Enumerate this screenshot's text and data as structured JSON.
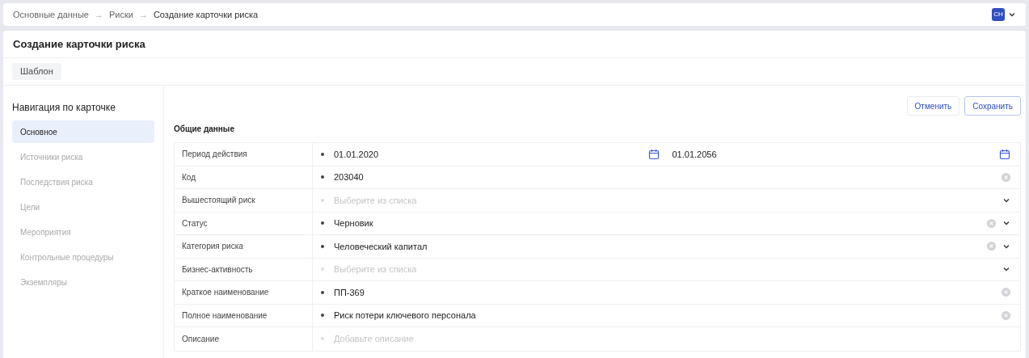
{
  "breadcrumbs": [
    "Основные данные",
    "Риски",
    "Создание карточки риска"
  ],
  "breadcrumb_separator": "→",
  "user": {
    "initials": "СН"
  },
  "page_title": "Создание карточки риска",
  "template_button": "Шаблон",
  "sidebar": {
    "title": "Навигация по карточке",
    "items": [
      {
        "label": "Основное",
        "selected": true
      },
      {
        "label": "Источники риска",
        "selected": false
      },
      {
        "label": "Последствия риска",
        "selected": false
      },
      {
        "label": "Цели",
        "selected": false
      },
      {
        "label": "Мероприятия",
        "selected": false
      },
      {
        "label": "Контрольные процедуры",
        "selected": false
      },
      {
        "label": "Экземпляры",
        "selected": false
      }
    ]
  },
  "actions": {
    "cancel": "Отменить",
    "save": "Сохранить"
  },
  "section_title": "Общие данные",
  "fields": [
    {
      "kind": "date_range",
      "label": "Период действия",
      "value": "01.01.2020",
      "value_end": "01.01.2056"
    },
    {
      "kind": "text",
      "label": "Код",
      "value": "203040",
      "clearable": true
    },
    {
      "kind": "select",
      "label": "Вышестоящий риск",
      "placeholder": "Выберите из списка",
      "clearable": false
    },
    {
      "kind": "select",
      "label": "Статус",
      "value": "Черновик",
      "clearable": true
    },
    {
      "kind": "select",
      "label": "Категория риска",
      "value": "Человеческий капитал",
      "clearable": true
    },
    {
      "kind": "select",
      "label": "Бизнес-активность",
      "placeholder": "Выберите из списка",
      "clearable": false
    },
    {
      "kind": "text",
      "label": "Краткое наименование",
      "value": "ПП-369",
      "clearable": true
    },
    {
      "kind": "text",
      "label": "Полное наименование",
      "value": "Риск потери ключевого персонала",
      "clearable": true
    },
    {
      "kind": "textarea",
      "label": "Описание",
      "placeholder": "Добавьте описание"
    }
  ]
}
